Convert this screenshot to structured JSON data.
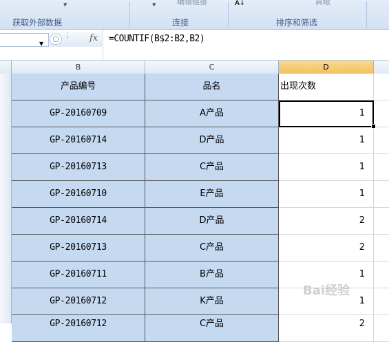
{
  "ribbon": {
    "groups": [
      {
        "label": "获取外部数据"
      },
      {
        "label": "连接",
        "faded_text": "编辑链接"
      },
      {
        "label": "排序和筛选",
        "faded_text": "高级"
      }
    ]
  },
  "formula_bar": {
    "fx_label": "fx",
    "formula": "=COUNTIF(B$2:B2,B2)"
  },
  "columns": [
    "B",
    "C",
    "D"
  ],
  "header_row": {
    "b": "产品编号",
    "c": "品名",
    "d": "出现次数"
  },
  "rows": [
    {
      "b": "GP-20160709",
      "c": "A产品",
      "d": "1"
    },
    {
      "b": "GP-20160714",
      "c": "D产品",
      "d": "1"
    },
    {
      "b": "GP-20160713",
      "c": "C产品",
      "d": "1"
    },
    {
      "b": "GP-20160710",
      "c": "E产品",
      "d": "1"
    },
    {
      "b": "GP-20160714",
      "c": "D产品",
      "d": "2"
    },
    {
      "b": "GP-20160713",
      "c": "C产品",
      "d": "2"
    },
    {
      "b": "GP-20160711",
      "c": "B产品",
      "d": "1"
    },
    {
      "b": "GP-20160712",
      "c": "K产品",
      "d": "1"
    },
    {
      "b": "GP-20160712",
      "c": "C产品",
      "d": "2"
    }
  ],
  "watermark": "Bai经验",
  "colors": {
    "selected_fill": "#c5d9f1",
    "active_col_header": "#f5c55f"
  }
}
